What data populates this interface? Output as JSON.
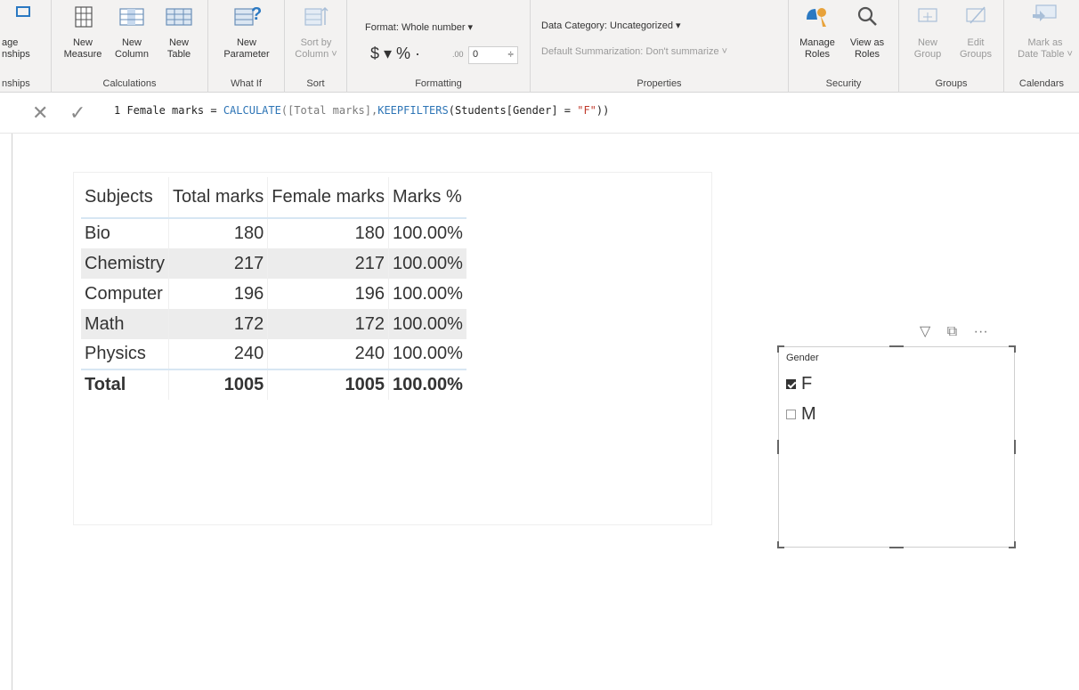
{
  "ribbon": {
    "relationships": {
      "lines": [
        "age",
        "nships"
      ],
      "group_label": "nships"
    },
    "calculations": {
      "group_label": "Calculations",
      "buttons": [
        {
          "l1": "New",
          "l2": "Measure",
          "icon": "measure-icon"
        },
        {
          "l1": "New",
          "l2": "Column",
          "icon": "column-icon"
        },
        {
          "l1": "New",
          "l2": "Table",
          "icon": "table-icon"
        }
      ]
    },
    "whatif": {
      "group_label": "What If",
      "button": {
        "l1": "New",
        "l2": "Parameter"
      }
    },
    "sort": {
      "group_label": "Sort",
      "button": {
        "l1": "Sort by",
        "l2": "Column ˅"
      }
    },
    "formatting": {
      "group_label": "Formatting",
      "format_value": "Format: Whole number ▾",
      "currency": "$ ▾ %  ·  ",
      "decimal_icon": ".00",
      "decimals": "0"
    },
    "properties": {
      "group_label": "Properties",
      "data_category": "Data Category: Uncategorized ▾",
      "summarization": "Default Summarization: Don't summarize ˅"
    },
    "security": {
      "group_label": "Security",
      "buttons": [
        {
          "l1": "Manage",
          "l2": "Roles"
        },
        {
          "l1": "View as",
          "l2": "Roles"
        }
      ]
    },
    "groups": {
      "group_label": "Groups",
      "buttons": [
        {
          "l1": "New",
          "l2": "Group"
        },
        {
          "l1": "Edit",
          "l2": "Groups"
        }
      ]
    },
    "calendars": {
      "group_label": "Calendars",
      "button": {
        "l1": "Mark as",
        "l2": "Date Table ˅"
      }
    }
  },
  "formula_bar": {
    "line_no": "1",
    "prefix": " Female marks = ",
    "fn1": "CALCULATE",
    "arg1": "([Total marks],",
    "fn2": "KEEPFILTERS",
    "arg2": "(Students[Gender] = ",
    "str": "\"F\"",
    "suffix": "))"
  },
  "table": {
    "headers": [
      "Subjects",
      "Total marks",
      "Female marks",
      "Marks %"
    ],
    "rows": [
      [
        "Bio",
        "180",
        "180",
        "100.00%"
      ],
      [
        "Chemistry",
        "217",
        "217",
        "100.00%"
      ],
      [
        "Computer",
        "196",
        "196",
        "100.00%"
      ],
      [
        "Math",
        "172",
        "172",
        "100.00%"
      ],
      [
        "Physics",
        "240",
        "240",
        "100.00%"
      ]
    ],
    "total": [
      "Total",
      "1005",
      "1005",
      "100.00%"
    ]
  },
  "slicer": {
    "title": "Gender",
    "options": [
      {
        "label": "F",
        "checked": true
      },
      {
        "label": "M",
        "checked": false
      }
    ],
    "tools": {
      "filter": "filter-icon",
      "focus": "focus-mode-icon",
      "more": "···"
    }
  }
}
